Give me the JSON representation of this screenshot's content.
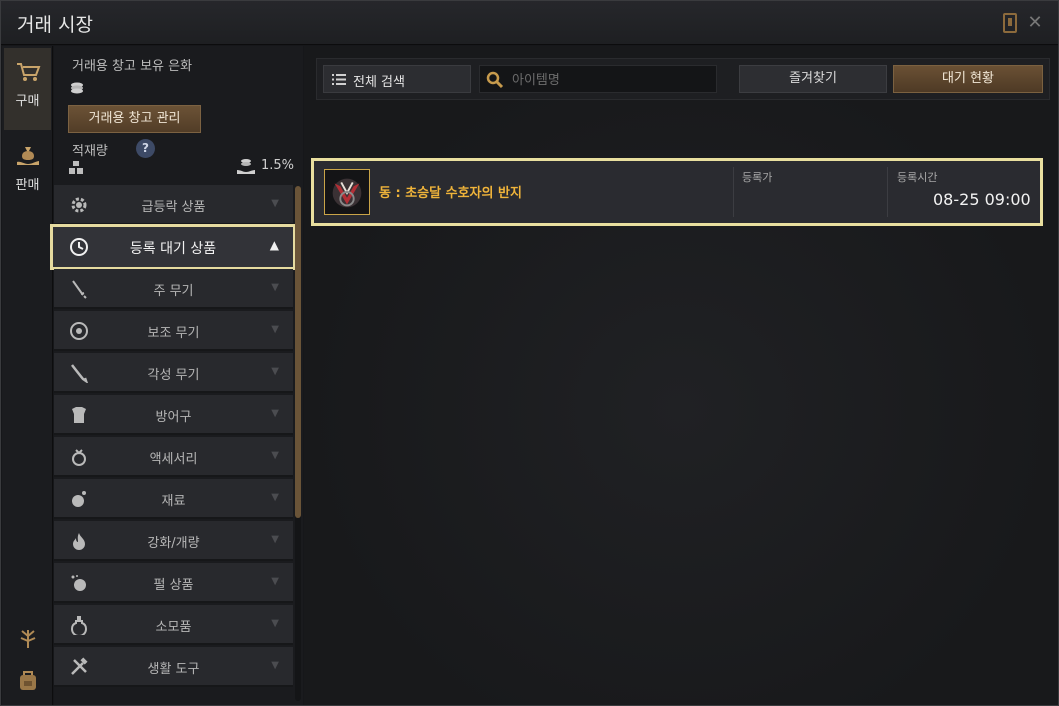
{
  "window": {
    "title": "거래 시장"
  },
  "rail": {
    "tabs": [
      {
        "label": "구매",
        "icon": "cart-icon",
        "active": true
      },
      {
        "label": "판매",
        "icon": "money-bag-icon",
        "active": false
      }
    ],
    "bottom_icons": [
      "tree-icon",
      "backpack-icon"
    ]
  },
  "wallet": {
    "label": "거래용 창고 보유 은화",
    "manage_button": "거래용 창고 관리",
    "weight_label": "적재량",
    "help": "?",
    "weight_percent": "1.5%"
  },
  "categories": [
    {
      "label": "급등락 상품",
      "icon": "gear-icon",
      "selected": false
    },
    {
      "label": "등록 대기 상품",
      "icon": "clock-icon",
      "selected": true
    },
    {
      "label": "주 무기",
      "icon": "sword-icon",
      "selected": false
    },
    {
      "label": "보조 무기",
      "icon": "shield-icon",
      "selected": false
    },
    {
      "label": "각성 무기",
      "icon": "blade-icon",
      "selected": false
    },
    {
      "label": "방어구",
      "icon": "armor-icon",
      "selected": false
    },
    {
      "label": "액세서리",
      "icon": "ring-icon",
      "selected": false
    },
    {
      "label": "재료",
      "icon": "ore-icon",
      "selected": false
    },
    {
      "label": "강화/개량",
      "icon": "flame-icon",
      "selected": false
    },
    {
      "label": "펄 상품",
      "icon": "pearl-icon",
      "selected": false
    },
    {
      "label": "소모품",
      "icon": "potion-icon",
      "selected": false
    },
    {
      "label": "생활 도구",
      "icon": "tools-icon",
      "selected": false
    }
  ],
  "toolbar": {
    "full_search": "전체 검색",
    "search_placeholder": "아이템명",
    "favorites": "즐겨찾기",
    "wait_status": "대기 현황"
  },
  "items": [
    {
      "name": "동 : 초승달 수호자의 반지",
      "price_label": "등록가",
      "price_value": "",
      "time_label": "등록시간",
      "time_value": "08-25 09:00",
      "icon": "ring-item-icon"
    }
  ],
  "colors": {
    "accent": "#e9df9f",
    "item_name": "#f0b43a",
    "brown_button": "#5e4630"
  }
}
